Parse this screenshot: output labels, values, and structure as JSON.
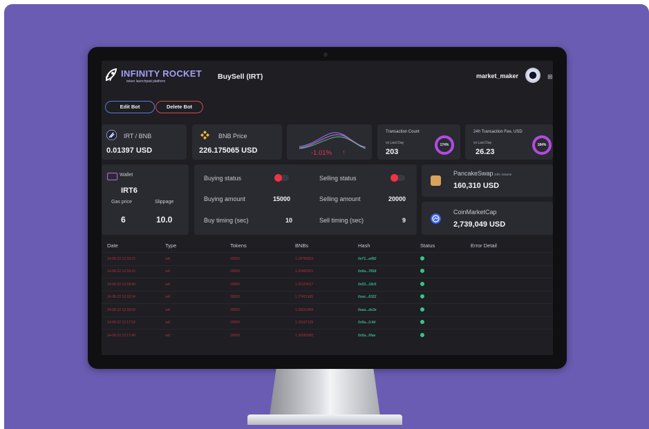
{
  "colors": {
    "frame_bg": "#6a5cb2",
    "screen_bg": "#1e1e23",
    "card_bg": "#2a2a31",
    "accent_purple": "#b24be0",
    "danger": "#ef3346",
    "success": "#34c789"
  },
  "header": {
    "logo_title": "INFINITY ROCKET",
    "logo_subtitle": "token launchpad platform",
    "page_title": "BuySell (IRT)",
    "username": "market_maker",
    "avatar_icon": "user-avatar",
    "menu_icon": "⊞"
  },
  "actions": {
    "edit": "Edit Bot",
    "delete": "Delete Bot"
  },
  "stats": {
    "pair": {
      "label": "IRT / BNB",
      "value": "0.01397 USD"
    },
    "bnb": {
      "label": "BNB Price",
      "value": "226.175065 USD"
    },
    "change": {
      "value": "-1.01%",
      "arrow": "↑"
    },
    "tx_count": {
      "title": "Transaction Count",
      "vs": "vs Last Day",
      "value": "203",
      "ring": "174%"
    },
    "fee": {
      "title": "24h Transaction Fee, USD",
      "vs": "vs Last Day",
      "value": "26.23",
      "ring": "184%"
    }
  },
  "wallet": {
    "label": "Wallet",
    "name": "IRT6",
    "gas_label": "Gas price",
    "gas_value": "6",
    "slippage_label": "Slippage",
    "slippage_value": "10.0"
  },
  "trading": {
    "buying_status": "Buying status",
    "buying_amount_label": "Buying amount",
    "buying_amount": "15000",
    "buy_timing_label": "Buy timing (sec)",
    "buy_timing": "10",
    "selling_status": "Selling status",
    "selling_amount_label": "Selling amount",
    "selling_amount": "20000",
    "sell_timing_label": "Sell timing (sec)",
    "sell_timing": "9"
  },
  "markets": {
    "pancake": {
      "name": "PancakeSwap",
      "sub": "24hr Volume",
      "value": "160,310 USD"
    },
    "cmc": {
      "name": "CoinMarketCap",
      "value": "2,739,049 USD"
    }
  },
  "table": {
    "headers": [
      "Date",
      "Type",
      "Tokens",
      "BNBs",
      "Hash",
      "Status",
      "Error Detail"
    ],
    "rows": [
      {
        "date": "14-08-22 12:18:15",
        "type": "sell",
        "tokens": "20000",
        "bnbs": "1.24756822",
        "hash": "0x71...a482"
      },
      {
        "date": "14-08-22 12:18:10",
        "type": "sell",
        "tokens": "20000",
        "bnbs": "1.25490921",
        "hash": "0x6a...7818"
      },
      {
        "date": "14-08-22 12:18:40",
        "type": "sell",
        "tokens": "20000",
        "bnbs": "1.26124017",
        "hash": "0x53...18c5"
      },
      {
        "date": "14-08-22 12:18:34",
        "type": "sell",
        "tokens": "20000",
        "bnbs": "1.27421165",
        "hash": "0xac...8322"
      },
      {
        "date": "14-08-22 12:18:09",
        "type": "sell",
        "tokens": "20000",
        "bnbs": "1.28210466",
        "hash": "0xaa...de3e"
      },
      {
        "date": "14-08-22 12:17:53",
        "type": "sell",
        "tokens": "20000",
        "bnbs": "1.29137105",
        "hash": "0x5a...0.4d"
      },
      {
        "date": "14-08-22 12:17:40",
        "type": "sell",
        "tokens": "20000",
        "bnbs": "1.30283582",
        "hash": "0x5a...f0ae"
      }
    ]
  }
}
